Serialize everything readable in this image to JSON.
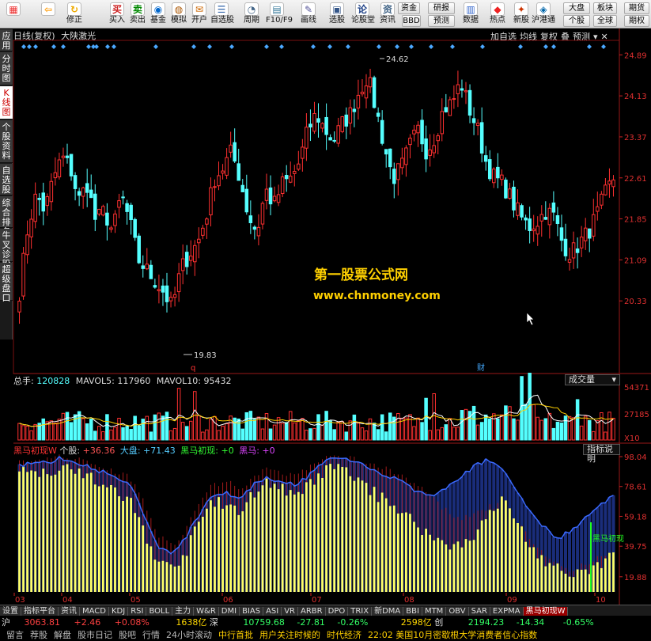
{
  "toolbar": {
    "buttons": [
      {
        "label": "",
        "name": "windows-icon-button"
      },
      {
        "label": "",
        "name": "back-arrow-button"
      },
      {
        "label": "修正",
        "name": "modify-button"
      },
      {
        "label": "买入",
        "name": "buy-button"
      },
      {
        "label": "卖出",
        "name": "sell-button"
      },
      {
        "label": "基金",
        "name": "fund-button"
      },
      {
        "label": "模拟",
        "name": "simulate-button"
      },
      {
        "label": "开户",
        "name": "open-account-button"
      },
      {
        "label": "自选股",
        "name": "watchlist-button"
      },
      {
        "label": "周期",
        "name": "period-button"
      },
      {
        "label": "F10/F9",
        "name": "f10-button"
      },
      {
        "label": "画线",
        "name": "draw-line-button"
      },
      {
        "label": "选股",
        "name": "stock-select-button"
      },
      {
        "label": "论股堂",
        "name": "forum-button"
      },
      {
        "label": "资讯",
        "name": "news-button"
      },
      {
        "label": "数据",
        "name": "data-button"
      },
      {
        "label": "热点",
        "name": "hotspot-button"
      },
      {
        "label": "新股",
        "name": "new-stock-button"
      },
      {
        "label": "沪港通",
        "name": "hk-connect-button"
      }
    ],
    "right_small": {
      "fund": "资金",
      "bbd": "BBD",
      "research": "研报",
      "forecast": "预测",
      "dapan": "大盘",
      "bankuai": "板块",
      "geigu": "个股",
      "quanqiu": "全球",
      "qihuo1": "期货",
      "qihuo2": "期权"
    }
  },
  "sidebar": [
    {
      "label": "应用",
      "active": false
    },
    {
      "label": "分时图",
      "active": false
    },
    {
      "label": "K线图",
      "active": true
    },
    {
      "label": "个股资料",
      "active": false
    },
    {
      "label": "自选股",
      "active": false
    },
    {
      "label": "综合排名",
      "active": false
    },
    {
      "label": "牛叉诊股",
      "active": false
    },
    {
      "label": "超级盘口",
      "active": false
    }
  ],
  "main": {
    "title": "日线(复权)",
    "indicator": "大陕激光",
    "controls": [
      "加自选",
      "均线",
      "复权",
      "叠",
      "预测"
    ],
    "price_axis": [
      "24.89",
      "24.13",
      "23.37",
      "22.61",
      "21.85",
      "21.09",
      "20.33"
    ],
    "high_label": "24.62",
    "low_label": "19.83",
    "watermark_cn": "第一股票公式网",
    "watermark_url": "www.chnmoney.com",
    "marker_q": "q",
    "marker_cai": "财"
  },
  "volume": {
    "label_total": "总手:",
    "total": "120828",
    "ma5_label": "MAVOL5:",
    "ma5": "117960",
    "ma10_label": "MAVOL10:",
    "ma10": "95432",
    "dropdown": "成交量",
    "axis": [
      "54371",
      "27185",
      "X10"
    ]
  },
  "indicator_pane": {
    "name": "黑马初现W",
    "geigu_label": "个股:",
    "geigu": "+36.36",
    "dapan_label": "大盘:",
    "dapan": "+71.43",
    "chuxian_label": "黑马初现:",
    "chuxian": "+0",
    "heima_label": "黑马:",
    "heima": "+0",
    "help": "指标说明",
    "axis": [
      "98.04",
      "78.61",
      "59.18",
      "39.75",
      "19.88"
    ],
    "annotation": "黑马初现"
  },
  "date_axis": [
    "03",
    "04",
    "05",
    "06",
    "07",
    "08",
    "09",
    "10"
  ],
  "bottom_tabs": [
    "设置",
    "指标平台",
    "资讯",
    "MACD",
    "KDJ",
    "RSI",
    "BOLL",
    "主力",
    "W&R",
    "DMI",
    "BIAS",
    "ASI",
    "VR",
    "ARBR",
    "DPO",
    "TRIX",
    "新DMA",
    "BBI",
    "MTM",
    "OBV",
    "SAR",
    "EXPMA",
    "黑马初现W"
  ],
  "status": {
    "sh_label": "沪",
    "sh_index": "3063.81",
    "sh_change": "+2.46",
    "sh_pct": "+0.08%",
    "sh_amount": "1638亿",
    "sz_label": "深",
    "sz_index": "10759.68",
    "sz_change": "-27.81",
    "sz_pct": "-0.26%",
    "sz_amount": "2598亿",
    "cy_label": "创",
    "cy_index": "2194.23",
    "cy_change": "-14.34",
    "cy_pct": "-0.65%",
    "row2": [
      "留言",
      "荐股",
      "解盘",
      "股市日记",
      "股吧",
      "行情",
      "24小时滚动",
      "中行首批",
      "用户关注时候的",
      "时代经济",
      "22:02 美国10月密歇根大学消费者信心指数"
    ]
  },
  "chart_data": {
    "type": "candlestick",
    "price_ylim": [
      19.6,
      25.1
    ],
    "high": 24.62,
    "low": 19.83,
    "volume_max": 54371,
    "indicator_ylim": [
      10,
      98.04
    ]
  }
}
